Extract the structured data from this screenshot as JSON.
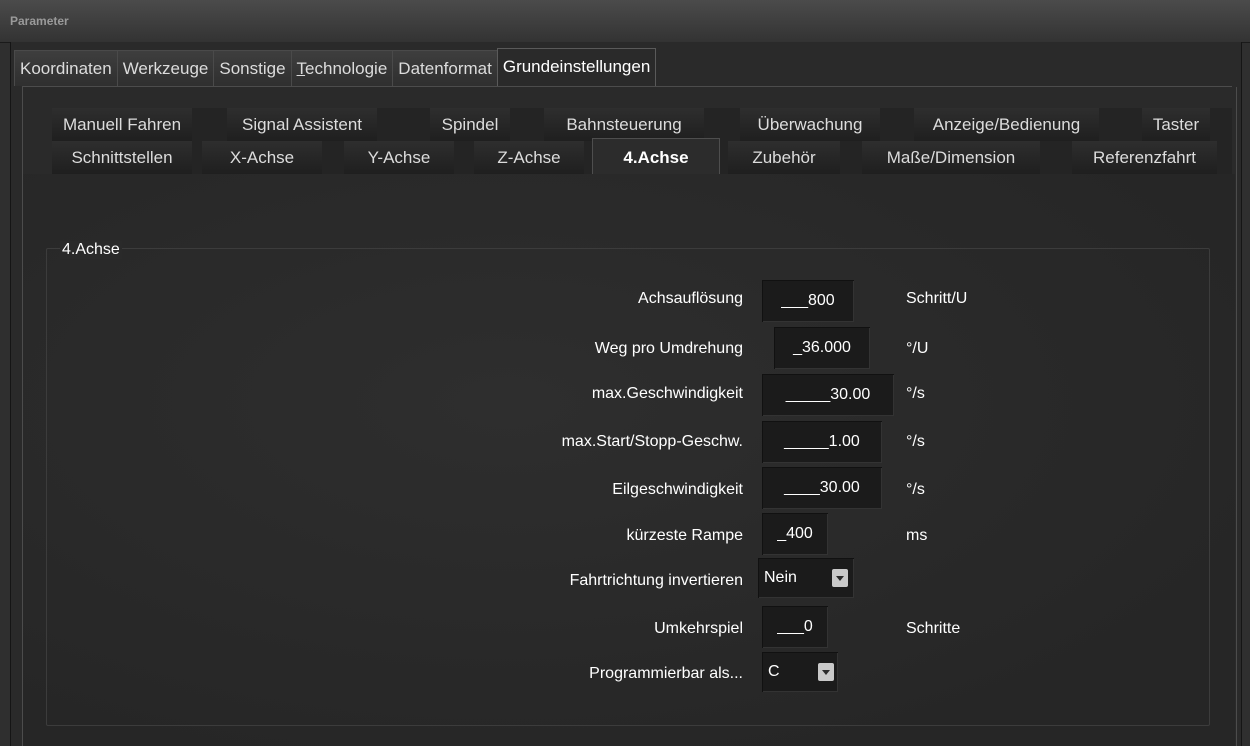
{
  "window": {
    "title": "Parameter"
  },
  "top_tabs": [
    {
      "label": "Koordinaten"
    },
    {
      "label": "Werkzeuge"
    },
    {
      "label": "Sonstige"
    },
    {
      "label_underlined": "T",
      "label_rest": "echnologie"
    },
    {
      "label": "Datenformat"
    },
    {
      "label": "Grundeinstellungen",
      "active": true
    }
  ],
  "sub_tabs_row1": [
    {
      "label": "Manuell Fahren"
    },
    {
      "label": "Signal Assistent"
    },
    {
      "label": "Spindel"
    },
    {
      "label": "Bahnsteuerung"
    },
    {
      "label": "Überwachung"
    },
    {
      "label": "Anzeige/Bedienung"
    },
    {
      "label": "Taster"
    }
  ],
  "sub_tabs_row2": [
    {
      "label": "Schnittstellen"
    },
    {
      "label": "X-Achse"
    },
    {
      "label": "Y-Achse"
    },
    {
      "label": "Z-Achse"
    },
    {
      "label": "4.Achse",
      "active": true
    },
    {
      "label": "Zubehör"
    },
    {
      "label": "Maße/Dimension"
    },
    {
      "label": "Referenzfahrt"
    }
  ],
  "group": {
    "title": "4.Achse",
    "fields": [
      {
        "label": "Achsauflösung",
        "value": "___800",
        "unit": "Schritt/U"
      },
      {
        "label": "Weg pro Umdrehung",
        "value": "_36.000",
        "unit": "°/U"
      },
      {
        "label": "max.Geschwindigkeit",
        "value": "_____30.00",
        "unit": "°/s"
      },
      {
        "label": "max.Start/Stopp-Geschw.",
        "value": "_____1.00",
        "unit": "°/s"
      },
      {
        "label": "Eilgeschwindigkeit",
        "value": "____30.00",
        "unit": "°/s"
      },
      {
        "label": "kürzeste Rampe",
        "value": "_400",
        "unit": "ms"
      },
      {
        "label": "Fahrtrichtung invertieren",
        "select_value": "Nein"
      },
      {
        "label": "Umkehrspiel",
        "value": "___0",
        "unit": "Schritte"
      },
      {
        "label": "Programmierbar als...",
        "select_value": "C"
      }
    ]
  },
  "icons": {
    "dropdown": "chevron-down-icon"
  }
}
